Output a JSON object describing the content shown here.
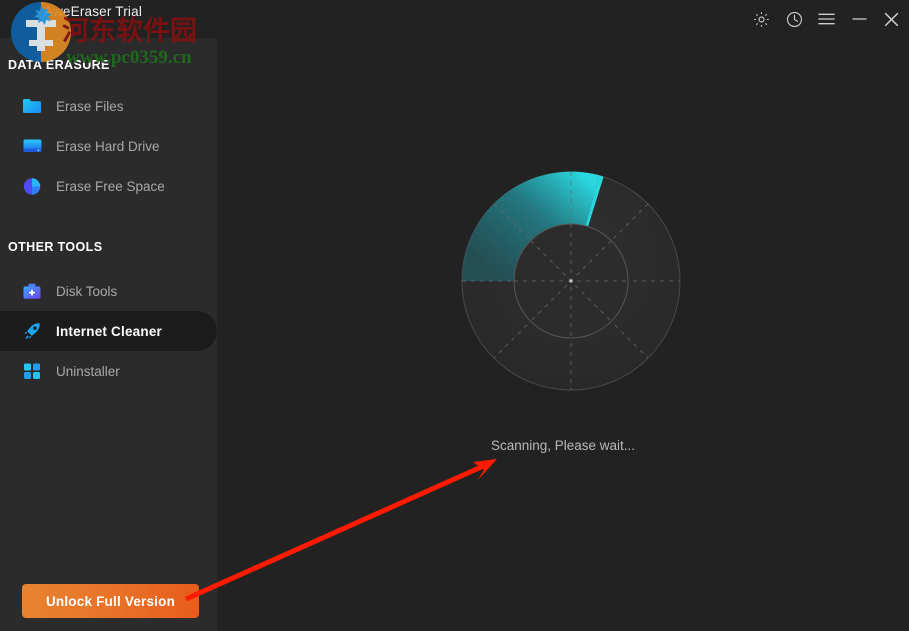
{
  "window": {
    "title": "AweEraser Trial",
    "controls": [
      {
        "name": "settings-icon",
        "label": "Settings"
      },
      {
        "name": "history-icon",
        "label": "History"
      },
      {
        "name": "menu-icon",
        "label": "Menu"
      },
      {
        "name": "minimize-icon",
        "label": "Minimize"
      },
      {
        "name": "close-icon",
        "label": "Close"
      }
    ]
  },
  "sidebar": {
    "sections": [
      {
        "title": "DATA ERASURE"
      },
      {
        "title": "OTHER TOOLS"
      }
    ],
    "items": [
      {
        "label": "Erase Files",
        "icon": "folder-icon",
        "selected": false
      },
      {
        "label": "Erase Hard Drive",
        "icon": "hard-drive-icon",
        "selected": false
      },
      {
        "label": "Erase Free Space",
        "icon": "pie-chart-icon",
        "selected": false
      },
      {
        "label": "Disk Tools",
        "icon": "toolbox-icon",
        "selected": false
      },
      {
        "label": "Internet Cleaner",
        "icon": "rocket-icon",
        "selected": true
      },
      {
        "label": "Uninstaller",
        "icon": "grid-squares-icon",
        "selected": false
      }
    ],
    "unlock_button": "Unlock Full Version"
  },
  "main": {
    "status": "Scanning, Please wait...",
    "scanner": {
      "type": "radar-sweep",
      "sweep_start_deg": 180,
      "sweep_end_deg": 285,
      "outer_radius": 110,
      "inner_radius": 57,
      "spokes": 8
    }
  },
  "watermark": {
    "site_cn": "河东软件园",
    "site_url": "www.pc0359.cn"
  },
  "colors": {
    "sidebar_bg": "#2b2b2b",
    "main_bg": "#222222",
    "selected_bg": "#1c1c1c",
    "accent_orange": "#e8752a",
    "sweep_cyan": "#2ad8e0",
    "sweep_teal": "#1d6b74",
    "text_muted": "#a8a8a8",
    "arrow_red": "#ff1a00"
  }
}
